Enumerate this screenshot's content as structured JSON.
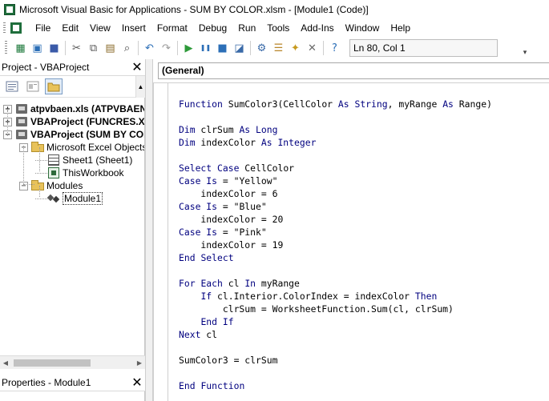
{
  "window": {
    "title": "Microsoft Visual Basic for Applications - SUM BY COLOR.xlsm - [Module1 (Code)]"
  },
  "menu": {
    "items": [
      "File",
      "Edit",
      "View",
      "Insert",
      "Format",
      "Debug",
      "Run",
      "Tools",
      "Add-Ins",
      "Window",
      "Help"
    ]
  },
  "toolbar": {
    "buttons": [
      {
        "name": "view-excel-icon",
        "glyph": "▦",
        "color": "#1f7a3d"
      },
      {
        "name": "insert-dropdown-icon",
        "glyph": "▣",
        "color": "#2c6fb7"
      },
      {
        "name": "save-icon",
        "glyph": "■",
        "color": "#3a5aa8"
      },
      {
        "name": "cut-icon",
        "glyph": "✂",
        "color": "#555555"
      },
      {
        "name": "copy-icon",
        "glyph": "⧉",
        "color": "#555555"
      },
      {
        "name": "paste-icon",
        "glyph": "▤",
        "color": "#8a6a2a"
      },
      {
        "name": "find-icon",
        "glyph": "⌕",
        "color": "#444444"
      },
      {
        "name": "undo-icon",
        "glyph": "↶",
        "color": "#2c6fb7"
      },
      {
        "name": "redo-icon",
        "glyph": "↷",
        "color": "#9a9a9a"
      },
      {
        "name": "run-icon",
        "glyph": "▶",
        "color": "#2e9a3a"
      },
      {
        "name": "break-icon",
        "glyph": "❚❚",
        "color": "#2c6fb7"
      },
      {
        "name": "reset-icon",
        "glyph": "■",
        "color": "#2c6fb7"
      },
      {
        "name": "design-mode-icon",
        "glyph": "◪",
        "color": "#3a6aa8"
      },
      {
        "name": "project-explorer-icon",
        "glyph": "⚙",
        "color": "#3a6aa8"
      },
      {
        "name": "properties-icon",
        "glyph": "☰",
        "color": "#b8862a"
      },
      {
        "name": "object-browser-icon",
        "glyph": "✦",
        "color": "#c79a1f"
      },
      {
        "name": "toolbox-icon",
        "glyph": "✕",
        "color": "#6a6a6a"
      },
      {
        "name": "help-icon",
        "glyph": "?",
        "color": "#2c6fb7"
      }
    ],
    "status": "Ln 80, Col 1"
  },
  "project_panel": {
    "title": "Project - VBAProject",
    "close": "✕",
    "tree": [
      {
        "label": "atpvbaen.xls (ATPVBAEN",
        "bold": true,
        "toggle": "+",
        "icon": "vba",
        "level": 0
      },
      {
        "label": "VBAProject (FUNCRES.XL",
        "bold": true,
        "toggle": "+",
        "icon": "vba",
        "level": 0
      },
      {
        "label": "VBAProject (SUM BY COL",
        "bold": true,
        "toggle": "−",
        "icon": "vba",
        "level": 0
      },
      {
        "label": "Microsoft Excel Objects",
        "bold": false,
        "toggle": "−",
        "icon": "folder",
        "level": 1
      },
      {
        "label": "Sheet1 (Sheet1)",
        "bold": false,
        "toggle": "",
        "icon": "sheet",
        "level": 2
      },
      {
        "label": "ThisWorkbook",
        "bold": false,
        "toggle": "",
        "icon": "workbook",
        "level": 2
      },
      {
        "label": "Modules",
        "bold": false,
        "toggle": "−",
        "icon": "folder",
        "level": 1
      },
      {
        "label": "Module1",
        "bold": false,
        "toggle": "",
        "icon": "module",
        "level": 2,
        "selected": true
      }
    ]
  },
  "properties_panel": {
    "title": "Properties - Module1",
    "close": "✕"
  },
  "code_window": {
    "object_dropdown": "(General)",
    "lines": [
      [
        {
          "t": "Function",
          "k": true
        },
        {
          "t": " SumColor3(CellColor "
        },
        {
          "t": "As",
          "k": true
        },
        {
          "t": " "
        },
        {
          "t": "String",
          "k": true
        },
        {
          "t": ", myRange "
        },
        {
          "t": "As",
          "k": true
        },
        {
          "t": " Range)"
        }
      ],
      [],
      [
        {
          "t": "Dim",
          "k": true
        },
        {
          "t": " clrSum "
        },
        {
          "t": "As",
          "k": true
        },
        {
          "t": " "
        },
        {
          "t": "Long",
          "k": true
        }
      ],
      [
        {
          "t": "Dim",
          "k": true
        },
        {
          "t": " indexColor "
        },
        {
          "t": "As",
          "k": true
        },
        {
          "t": " "
        },
        {
          "t": "Integer",
          "k": true
        }
      ],
      [],
      [
        {
          "t": "Select",
          "k": true
        },
        {
          "t": " "
        },
        {
          "t": "Case",
          "k": true
        },
        {
          "t": " CellColor"
        }
      ],
      [
        {
          "t": "Case",
          "k": true
        },
        {
          "t": " "
        },
        {
          "t": "Is",
          "k": true
        },
        {
          "t": " = \"Yellow\""
        }
      ],
      [
        {
          "t": "    indexColor = 6"
        }
      ],
      [
        {
          "t": "Case",
          "k": true
        },
        {
          "t": " "
        },
        {
          "t": "Is",
          "k": true
        },
        {
          "t": " = \"Blue\""
        }
      ],
      [
        {
          "t": "    indexColor = 20"
        }
      ],
      [
        {
          "t": "Case",
          "k": true
        },
        {
          "t": " "
        },
        {
          "t": "Is",
          "k": true
        },
        {
          "t": " = \"Pink\""
        }
      ],
      [
        {
          "t": "    indexColor = 19"
        }
      ],
      [
        {
          "t": "End",
          "k": true
        },
        {
          "t": " "
        },
        {
          "t": "Select",
          "k": true
        }
      ],
      [],
      [
        {
          "t": "For",
          "k": true
        },
        {
          "t": " "
        },
        {
          "t": "Each",
          "k": true
        },
        {
          "t": " cl "
        },
        {
          "t": "In",
          "k": true
        },
        {
          "t": " myRange"
        }
      ],
      [
        {
          "t": "    "
        },
        {
          "t": "If",
          "k": true
        },
        {
          "t": " cl.Interior.ColorIndex = indexColor "
        },
        {
          "t": "Then",
          "k": true
        }
      ],
      [
        {
          "t": "        clrSum = WorksheetFunction.Sum(cl, clrSum)"
        }
      ],
      [
        {
          "t": "    "
        },
        {
          "t": "End",
          "k": true
        },
        {
          "t": " "
        },
        {
          "t": "If",
          "k": true
        }
      ],
      [
        {
          "t": "Next",
          "k": true
        },
        {
          "t": " cl"
        }
      ],
      [],
      [
        {
          "t": "SumColor3 = clrSum"
        }
      ],
      [],
      [
        {
          "t": "End",
          "k": true
        },
        {
          "t": " "
        },
        {
          "t": "Function",
          "k": true
        }
      ]
    ]
  },
  "colors": {
    "keyword": "#00007f",
    "text": "#000000"
  }
}
